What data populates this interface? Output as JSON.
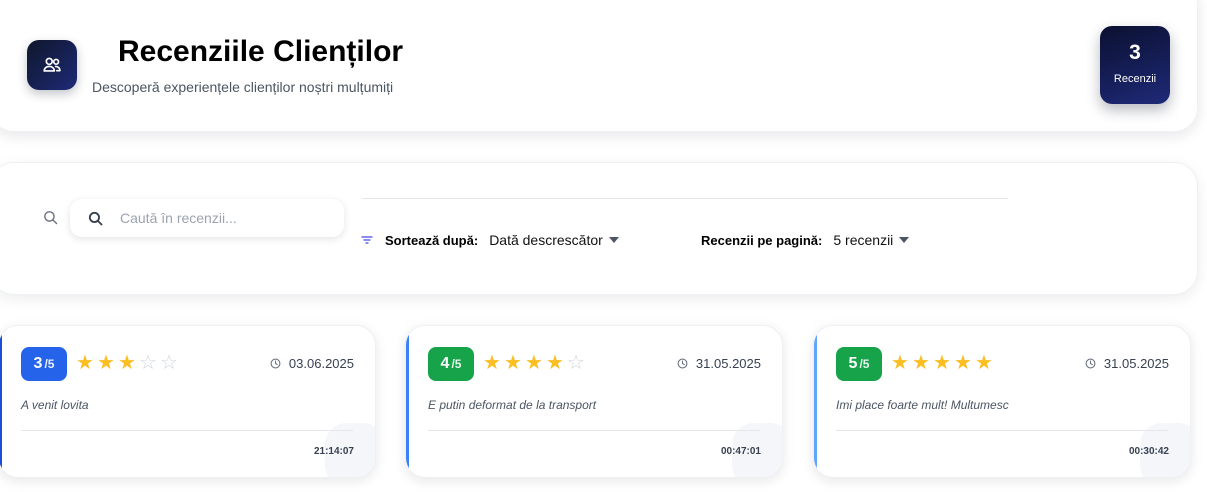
{
  "header": {
    "title": "Recenziile Clienților",
    "subtitle": "Descoperă experiențele clienților noștri mulțumiți",
    "icon": "users-icon",
    "count_value": "3",
    "count_label": "Recenzii"
  },
  "filters": {
    "search_placeholder": "Caută în recenzii...",
    "search_value": "",
    "sort_label": "Sortează după:",
    "sort_value": "Dată descrescător",
    "per_page_label": "Recenzii pe pagină:",
    "per_page_value": "5 recenzii"
  },
  "colors": {
    "blue": "#2563eb",
    "green": "#16a34a",
    "star": "#fbbf24",
    "header_dark": "#0f172a"
  },
  "reviews": [
    {
      "rating": "3",
      "max": "/5",
      "stars": 3,
      "date": "03.06.2025",
      "text": "A venit lovita",
      "time": "21:14:07",
      "badge_color": "#2563eb",
      "accent_color": "#1d4ed8"
    },
    {
      "rating": "4",
      "max": "/5",
      "stars": 4,
      "date": "31.05.2025",
      "text": "E putin deformat de la transport",
      "time": "00:47:01",
      "badge_color": "#16a34a",
      "accent_color": "#3b82f6"
    },
    {
      "rating": "5",
      "max": "/5",
      "stars": 5,
      "date": "31.05.2025",
      "text": "Imi place foarte mult! Multumesc",
      "time": "00:30:42",
      "badge_color": "#16a34a",
      "accent_color": "#60a5fa"
    }
  ]
}
